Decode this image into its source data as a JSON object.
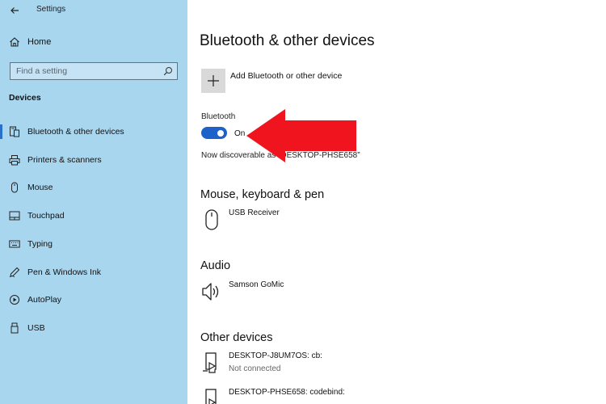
{
  "window": {
    "title": "Settings"
  },
  "sidebar": {
    "home_label": "Home",
    "search_placeholder": "Find a setting",
    "section_title": "Devices",
    "items": [
      {
        "label": "Bluetooth & other devices",
        "icon": "bluetooth-devices-icon",
        "active": true
      },
      {
        "label": "Printers & scanners",
        "icon": "printer-icon"
      },
      {
        "label": "Mouse",
        "icon": "mouse-icon"
      },
      {
        "label": "Touchpad",
        "icon": "touchpad-icon"
      },
      {
        "label": "Typing",
        "icon": "keyboard-icon"
      },
      {
        "label": "Pen & Windows Ink",
        "icon": "pen-icon"
      },
      {
        "label": "AutoPlay",
        "icon": "autoplay-icon"
      },
      {
        "label": "USB",
        "icon": "usb-icon"
      }
    ]
  },
  "main": {
    "title": "Bluetooth & other devices",
    "add_device_label": "Add Bluetooth or other device",
    "bluetooth": {
      "label": "Bluetooth",
      "state": "On",
      "discoverable_text": "Now discoverable as “DESKTOP-PHSE658”"
    },
    "sections": {
      "mouse_keyboard_pen": {
        "title": "Mouse, keyboard & pen",
        "devices": [
          {
            "name": "USB Receiver",
            "icon": "mouse-device-icon"
          }
        ]
      },
      "audio": {
        "title": "Audio",
        "devices": [
          {
            "name": "Samson GoMic",
            "icon": "speaker-icon"
          }
        ]
      },
      "other_devices": {
        "title": "Other devices",
        "devices": [
          {
            "name": "DESKTOP-J8UM7OS: cb:",
            "status": "Not connected",
            "icon": "device-icon"
          },
          {
            "name": "DESKTOP-PHSE658: codebind:",
            "icon": "device-icon"
          }
        ]
      }
    }
  },
  "colors": {
    "sidebar_bg": "#a9d6ef",
    "accent": "#1c62c9",
    "annotation_arrow": "#f0141e"
  }
}
